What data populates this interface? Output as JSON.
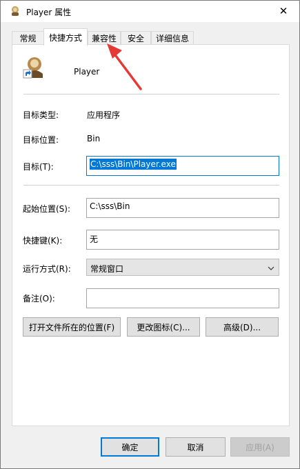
{
  "window": {
    "title": "Player 属性",
    "close_glyph": "✕"
  },
  "tabs": [
    {
      "label": "常规"
    },
    {
      "label": "快捷方式"
    },
    {
      "label": "兼容性"
    },
    {
      "label": "安全"
    },
    {
      "label": "详细信息"
    }
  ],
  "shortcut": {
    "name": "Player",
    "target_type_label": "目标类型:",
    "target_type_value": "应用程序",
    "target_location_label": "目标位置:",
    "target_location_value": "Bin",
    "target_label": "目标(T):",
    "target_value": "C:\\sss\\Bin\\Player.exe",
    "start_in_label": "起始位置(S):",
    "start_in_value": "C:\\sss\\Bin",
    "hotkey_label": "快捷键(K):",
    "hotkey_value": "无",
    "run_label": "运行方式(R):",
    "run_value": "常规窗口",
    "comment_label": "备注(O):",
    "comment_value": ""
  },
  "actions": {
    "open_location": "打开文件所在的位置(F)",
    "change_icon": "更改图标(C)...",
    "advanced": "高级(D)..."
  },
  "footer": {
    "ok": "确定",
    "cancel": "取消",
    "apply": "应用(A)"
  },
  "colors": {
    "selection": "#0078d7",
    "annotation_arrow": "#e53935"
  }
}
